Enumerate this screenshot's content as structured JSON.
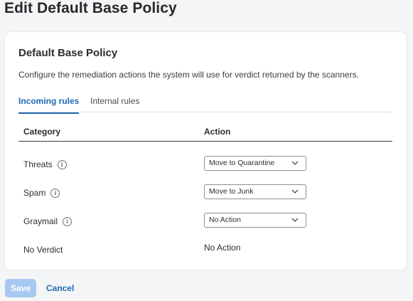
{
  "page": {
    "title": "Edit Default Base Policy"
  },
  "card": {
    "title": "Default Base Policy",
    "description": "Configure the remediation actions the system will use for verdict returned by the scanners."
  },
  "tabs": [
    {
      "label": "Incoming rules",
      "active": true
    },
    {
      "label": "Internal rules",
      "active": false
    }
  ],
  "table": {
    "headers": {
      "category": "Category",
      "action": "Action"
    },
    "rows": [
      {
        "category": "Threats",
        "info_icon": "info-circle-icon",
        "action": "Move to Quarantine",
        "type": "select"
      },
      {
        "category": "Spam",
        "info_icon": "info-circle-icon",
        "action": "Move to Junk",
        "type": "select"
      },
      {
        "category": "Graymail",
        "info_icon": "info-circle-icon",
        "action": "No Action",
        "type": "select"
      },
      {
        "category": "No Verdict",
        "action": "No Action",
        "type": "text"
      }
    ]
  },
  "footer": {
    "save_label": "Save",
    "cancel_label": "Cancel"
  },
  "colors": {
    "accent": "#1f69b3",
    "save_disabled": "#a8c9ef"
  }
}
